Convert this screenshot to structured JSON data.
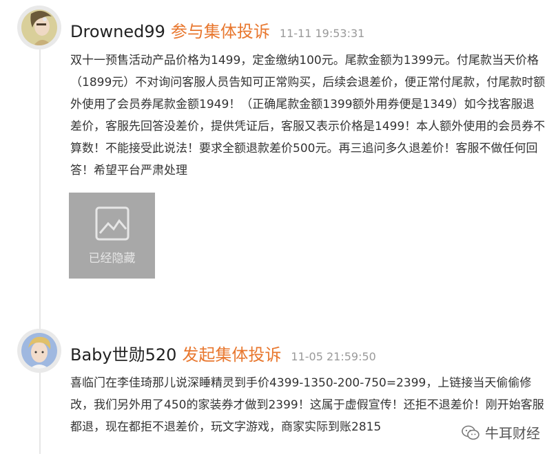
{
  "posts": [
    {
      "username": "Drowned99",
      "action": "参与集体投诉",
      "time": "11-11 19:53:31",
      "body": "双十一预售活动产品价格为1499，定金缴纳100元。尾款金额为1399元。付尾款当天价格（1899元）不对询问客服人员告知可正常购买，后续会退差价，便正常付尾款，付尾款时额外使用了会员券尾款金额1949！（正确尾款金额1399额外用券便是1349）如今找客服退差价，客服先回答没差价，提供凭证后，客服又表示价格是1499！本人额外使用的会员券不算数！不能接受此说法！要求全额退款差价500元。再三追问多久退差价！客服不做任何回答！希望平台严肃处理",
      "image_label": "已经隐藏"
    },
    {
      "username": "Baby世勋520",
      "action": "发起集体投诉",
      "time": "11-05 21:59:50",
      "body": "喜临门在李佳琦那儿说深睡精灵到手价4399-1350-200-750=2399，上链接当天偷偷修改，我们另外用了450的家装券才做到2399！这属于虚假宣传！还拒不退差价！刚开始客服都退，现在都拒不退差价，玩文字游戏，商家实际到账2815"
    }
  ],
  "watermark": {
    "text": "牛耳财经"
  },
  "colors": {
    "accent": "#e8772e",
    "time": "#999999",
    "placeholder_bg": "#a8a8a8"
  }
}
